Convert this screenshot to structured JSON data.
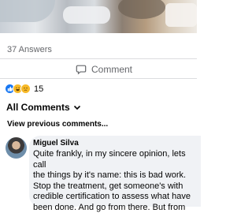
{
  "post": {
    "answers_count": "37 Answers",
    "comment_label": "Comment",
    "reaction_count": "15",
    "reactions": [
      "like-icon",
      "haha-icon",
      "sad-icon"
    ]
  },
  "comments_section": {
    "filter_label": "All Comments",
    "view_previous": "View previous comments..."
  },
  "comment": {
    "author": "Miguel Silva",
    "text": "Quite frankly, in my sincere opinion, lets call\nthe things by it's name: this is bad work.\nStop the treatment, get someone's with\ncredible certification to assess what have\nbeen done.  And go from there. But from"
  },
  "colors": {
    "secondary_text": "#65676b",
    "bubble_bg": "#f0f2f5",
    "like_blue": "#1877f2",
    "emoji_yellow": "#f7b928"
  }
}
